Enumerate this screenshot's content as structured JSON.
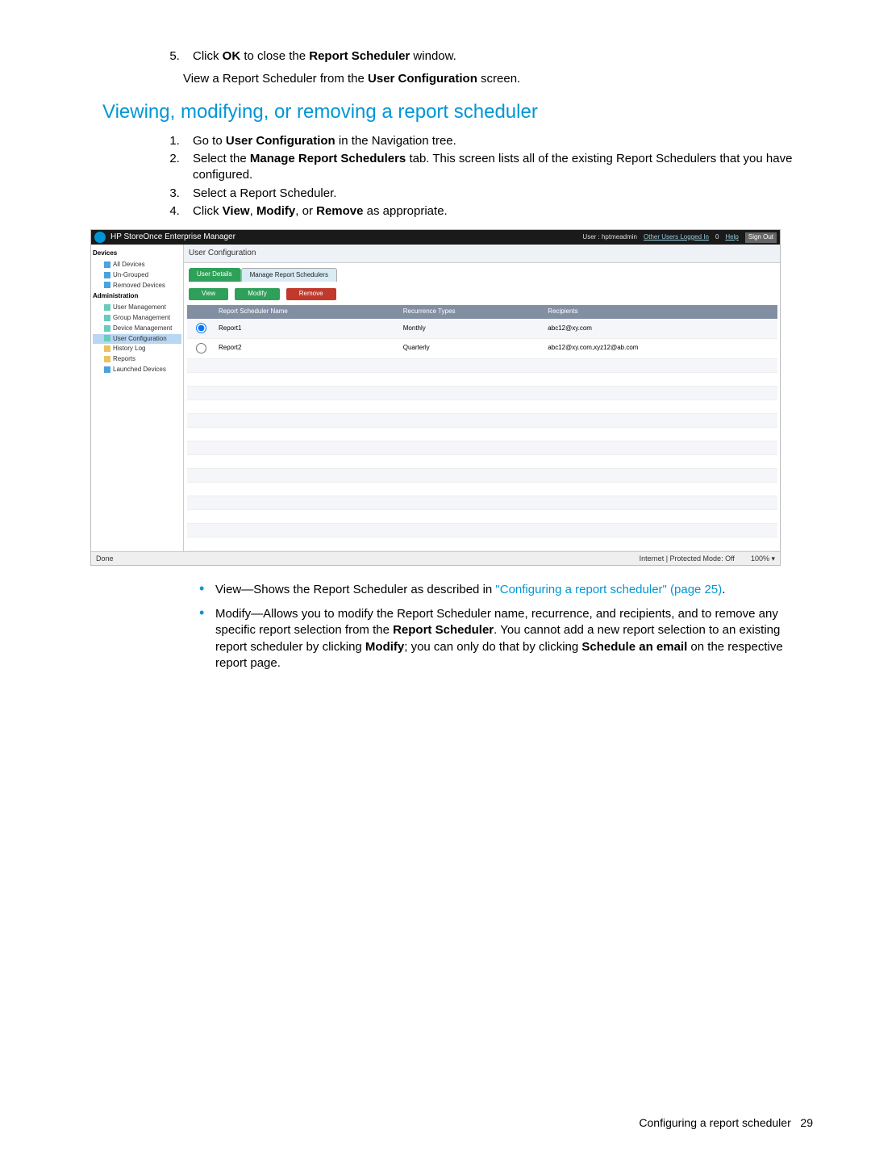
{
  "step5": {
    "num": "5.",
    "pre": "Click ",
    "b1": "OK",
    "mid": " to close the ",
    "b2": "Report Scheduler",
    "post": " window."
  },
  "para1_pre": "View a Report Scheduler from the ",
  "para1_bold": "User Configuration",
  "para1_post": " screen.",
  "h2": "Viewing, modifying, or removing a report scheduler",
  "steps": [
    {
      "num": "1.",
      "pre": "Go to ",
      "b": "User Configuration",
      "post": " in the Navigation tree."
    },
    {
      "num": "2.",
      "pre": "Select the ",
      "b": "Manage Report Schedulers",
      "post": " tab. This screen lists all of the existing Report Schedulers that you have configured."
    },
    {
      "num": "3.",
      "plain": "Select a Report Scheduler."
    },
    {
      "num": "4.",
      "pre": "Click ",
      "b1": "View",
      "mid1": ", ",
      "b2": "Modify",
      "mid2": ", or ",
      "b3": "Remove",
      "post": " as appropriate."
    }
  ],
  "shot": {
    "title": "HP StoreOnce Enterprise Manager",
    "user_label": "User : hptmeadmin",
    "other_users": "Other Users Logged In",
    "other_users_count": "0",
    "help": "Help",
    "sign_out": "Sign Out",
    "page_label": "User Configuration",
    "nav": {
      "grp1": "Devices",
      "items1": [
        "All Devices",
        "Un-Grouped",
        "Removed Devices"
      ],
      "grp2": "Administration",
      "items2": [
        "User Management",
        "Group Management",
        "Device Management",
        "User Configuration"
      ],
      "items3": [
        "History Log",
        "Reports",
        "Launched Devices"
      ]
    },
    "tabs": [
      "User Details",
      "Manage Report Schedulers"
    ],
    "buttons": [
      "View",
      "Modify",
      "Remove"
    ],
    "cols": [
      "",
      "Report Scheduler Name",
      "Recurrence Types",
      "Recipients"
    ],
    "rows": [
      {
        "sel": true,
        "name": "Report1",
        "rec": "Monthly",
        "to": "abc12@xy.com"
      },
      {
        "sel": false,
        "name": "Report2",
        "rec": "Quarterly",
        "to": "abc12@xy.com,xyz12@ab.com"
      }
    ],
    "status_left": "Done",
    "status_right": "Internet | Protected Mode: Off",
    "zoom": "100%"
  },
  "bullets": [
    {
      "lead": "View—Shows the Report Scheduler as described in ",
      "link": "\"Configuring a report scheduler\" (page 25)",
      "tail": "."
    },
    {
      "lead": "Modify—Allows you to modify the Report Scheduler name, recurrence, and recipients, and to remove any specific report selection from the ",
      "b1": "Report Scheduler",
      "mid1": ". You cannot add a new report selection to an existing report scheduler by clicking ",
      "b2": "Modify",
      "mid2": "; you can only do that by clicking ",
      "b3": "Schedule an email",
      "tail": " on the respective report page."
    }
  ],
  "footer_label": "Configuring a report scheduler",
  "footer_page": "29"
}
